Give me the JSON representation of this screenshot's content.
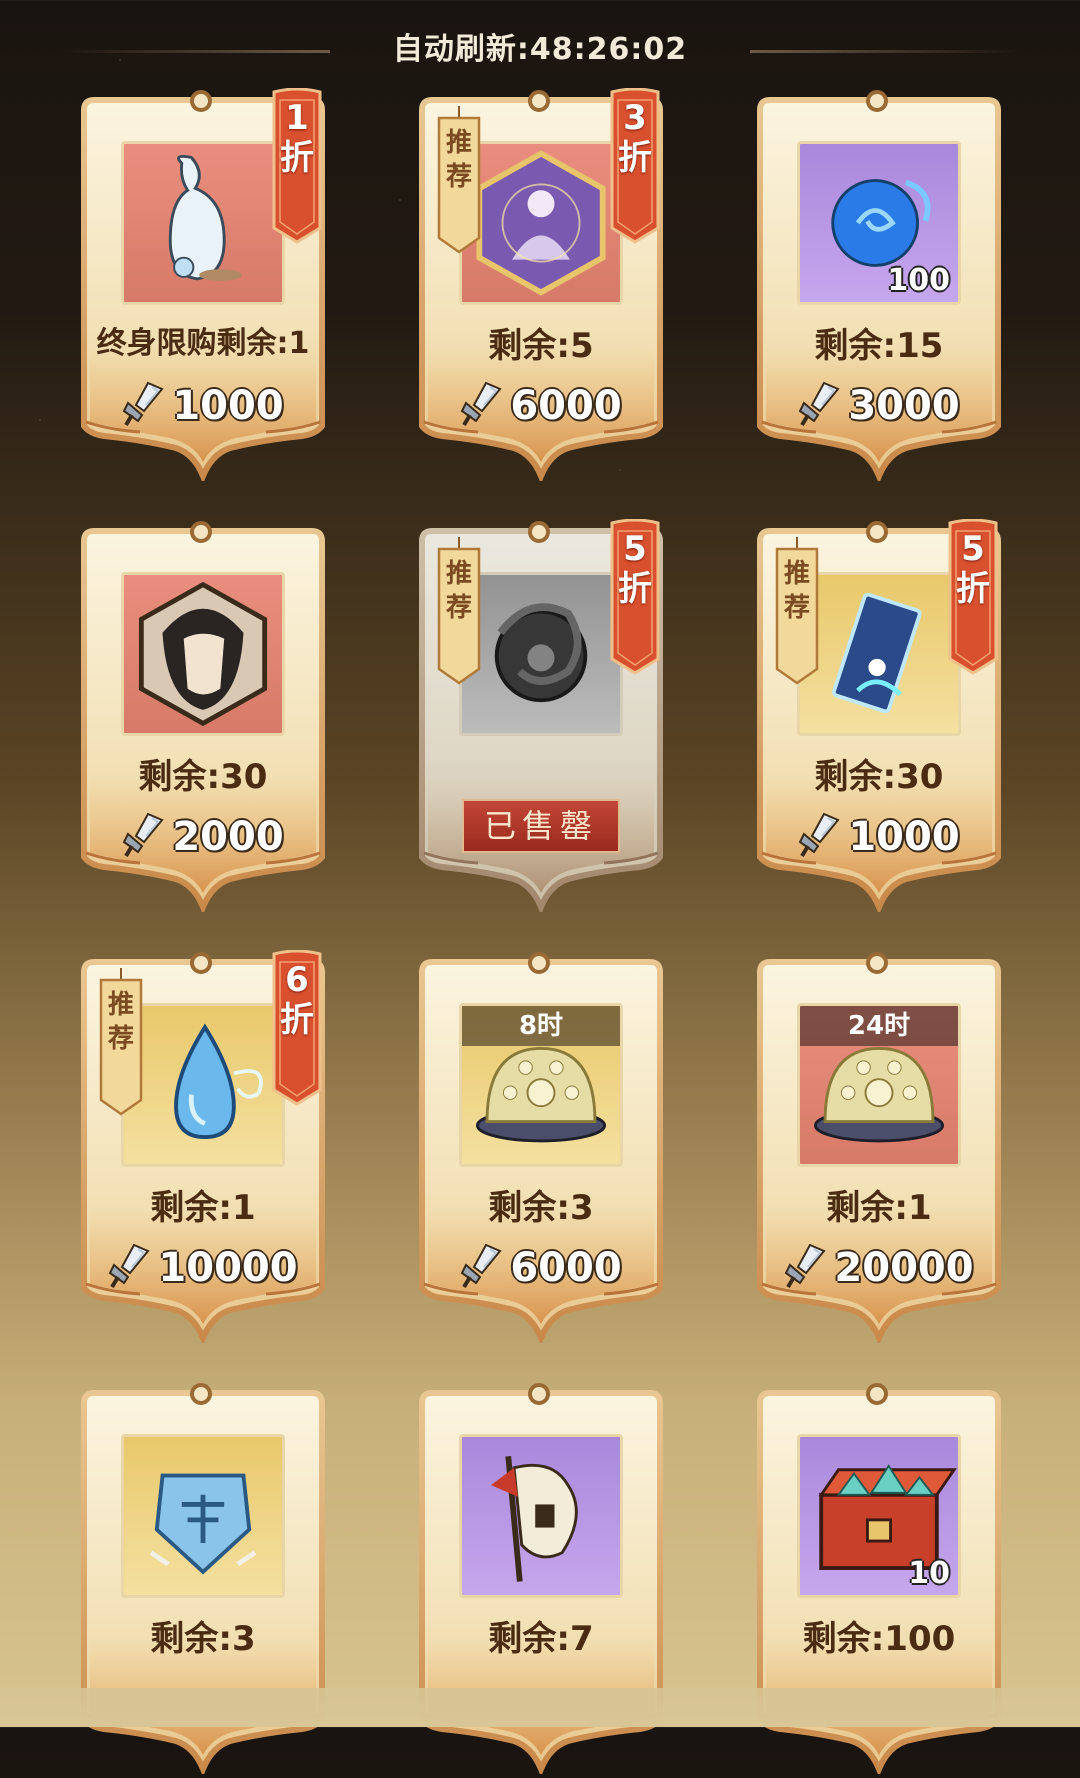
{
  "header": {
    "refresh_label": "自动刷新:48:26:02"
  },
  "colors": {
    "card_paper": "#f6ecd2",
    "card_border": "#e0a868",
    "discount_red": "#d8502e",
    "price_text": "#ffffff"
  },
  "currency_icon": "crystal-spear-icon",
  "items": [
    {
      "id": "item-1",
      "icon": "gourd-vase-icon",
      "bg": "red",
      "stock": "终身限购剩余:1",
      "price": "1000",
      "discount": "1折"
    },
    {
      "id": "item-2",
      "icon": "hero-hexagon-icon",
      "bg": "red",
      "stock": "剩余:5",
      "price": "6000",
      "discount": "3折",
      "recommend": "推荐"
    },
    {
      "id": "item-3",
      "icon": "blue-orb-icon",
      "bg": "purple",
      "stock": "剩余:15",
      "price": "3000",
      "qty": "100"
    },
    {
      "id": "item-4",
      "icon": "warrior-portrait-icon",
      "bg": "red",
      "stock": "剩余:30",
      "price": "2000"
    },
    {
      "id": "item-5",
      "icon": "dragon-token-icon",
      "bg": "gray",
      "discount": "5折",
      "recommend": "推荐",
      "sold_label": "已售罄"
    },
    {
      "id": "item-6",
      "icon": "talisman-scroll-icon",
      "bg": "gold",
      "stock": "剩余:30",
      "price": "1000",
      "discount": "5折",
      "recommend": "推荐"
    },
    {
      "id": "item-7",
      "icon": "water-drop-icon",
      "bg": "gold",
      "stock": "剩余:1",
      "price": "10000",
      "discount": "6折",
      "recommend": "推荐"
    },
    {
      "id": "item-8",
      "icon": "compass-disc-icon",
      "bg": "gold",
      "stock": "剩余:3",
      "price": "6000",
      "time_tag": "8时"
    },
    {
      "id": "item-9",
      "icon": "compass-disc-icon",
      "bg": "red",
      "stock": "剩余:1",
      "price": "20000",
      "time_tag": "24时"
    },
    {
      "id": "item-10",
      "icon": "blue-badge-icon",
      "bg": "gold",
      "stock": "剩余:3"
    },
    {
      "id": "item-11",
      "icon": "war-banner-icon",
      "bg": "purple",
      "stock": "剩余:7"
    },
    {
      "id": "item-12",
      "icon": "treasure-chest-icon",
      "bg": "purple",
      "stock": "剩余:100",
      "qty": "10"
    }
  ]
}
